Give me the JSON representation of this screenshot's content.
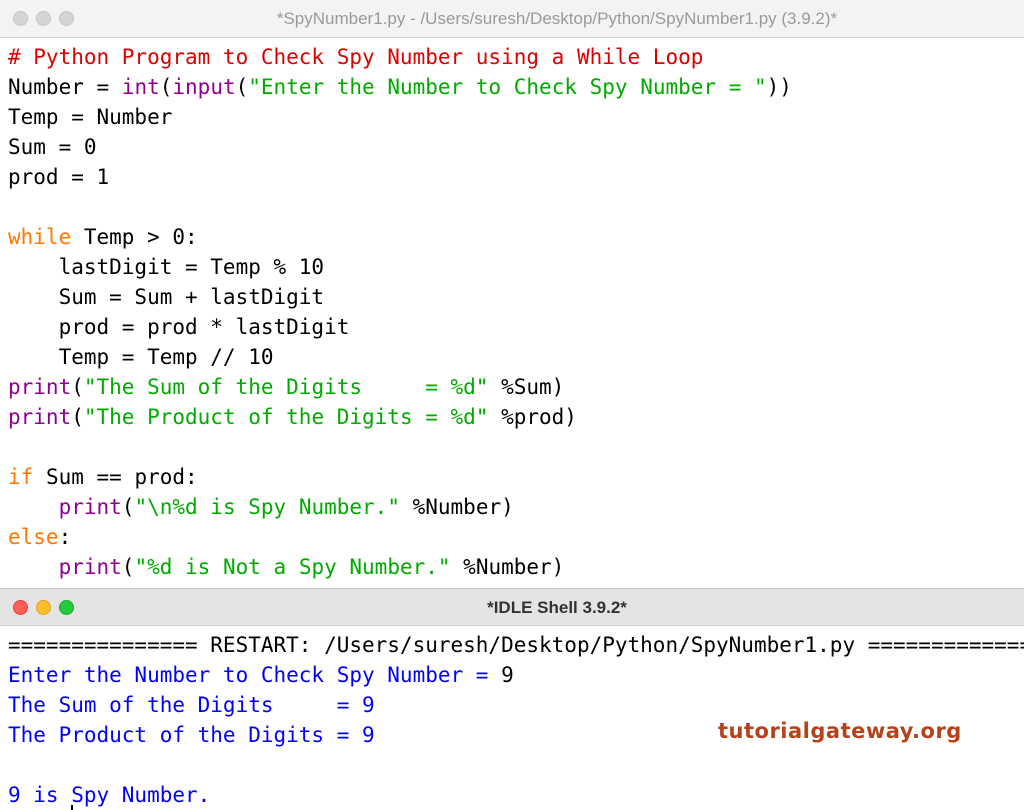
{
  "editor": {
    "title": "*SpyNumber1.py - /Users/suresh/Desktop/Python/SpyNumber1.py (3.9.2)*",
    "lines": [
      [
        {
          "t": "# Python Program to Check Spy Number using a While Loop",
          "c": "comment"
        }
      ],
      [
        {
          "t": "Number = ",
          "c": "plain"
        },
        {
          "t": "int",
          "c": "builtin"
        },
        {
          "t": "(",
          "c": "plain"
        },
        {
          "t": "input",
          "c": "builtin"
        },
        {
          "t": "(",
          "c": "plain"
        },
        {
          "t": "\"Enter the Number to Check Spy Number = \"",
          "c": "str"
        },
        {
          "t": "))",
          "c": "plain"
        }
      ],
      [
        {
          "t": "Temp = Number",
          "c": "plain"
        }
      ],
      [
        {
          "t": "Sum = 0",
          "c": "plain"
        }
      ],
      [
        {
          "t": "prod = 1",
          "c": "plain"
        }
      ],
      [
        {
          "t": "",
          "c": "plain"
        }
      ],
      [
        {
          "t": "while",
          "c": "kw"
        },
        {
          "t": " Temp > 0:",
          "c": "plain"
        }
      ],
      [
        {
          "t": "    lastDigit = Temp % 10",
          "c": "plain"
        }
      ],
      [
        {
          "t": "    Sum = Sum + lastDigit",
          "c": "plain"
        }
      ],
      [
        {
          "t": "    prod = prod * lastDigit",
          "c": "plain"
        }
      ],
      [
        {
          "t": "    Temp = Temp // 10",
          "c": "plain"
        }
      ],
      [
        {
          "t": "print",
          "c": "builtin"
        },
        {
          "t": "(",
          "c": "plain"
        },
        {
          "t": "\"The Sum of the Digits     = %d\"",
          "c": "str"
        },
        {
          "t": " %Sum)",
          "c": "plain"
        }
      ],
      [
        {
          "t": "print",
          "c": "builtin"
        },
        {
          "t": "(",
          "c": "plain"
        },
        {
          "t": "\"The Product of the Digits = %d\"",
          "c": "str"
        },
        {
          "t": " %prod)",
          "c": "plain"
        }
      ],
      [
        {
          "t": "",
          "c": "plain"
        }
      ],
      [
        {
          "t": "if",
          "c": "kw"
        },
        {
          "t": " Sum == prod:",
          "c": "plain"
        }
      ],
      [
        {
          "t": "    ",
          "c": "plain"
        },
        {
          "t": "print",
          "c": "builtin"
        },
        {
          "t": "(",
          "c": "plain"
        },
        {
          "t": "\"\\n%d is Spy Number.\"",
          "c": "str"
        },
        {
          "t": " %Number)",
          "c": "plain"
        }
      ],
      [
        {
          "t": "else",
          "c": "kw"
        },
        {
          "t": ":",
          "c": "plain"
        }
      ],
      [
        {
          "t": "    ",
          "c": "plain"
        },
        {
          "t": "print",
          "c": "builtin"
        },
        {
          "t": "(",
          "c": "plain"
        },
        {
          "t": "\"%d is Not a Spy Number.\"",
          "c": "str"
        },
        {
          "t": " %Number)",
          "c": "plain"
        }
      ]
    ]
  },
  "shell": {
    "title": "*IDLE Shell 3.9.2*",
    "lines": [
      [
        {
          "t": "=============== RESTART: /Users/suresh/Desktop/Python/SpyNumber1.py =============",
          "c": "plain"
        }
      ],
      [
        {
          "t": "Enter the Number to Check Spy Number = ",
          "c": "out"
        },
        {
          "t": "9",
          "c": "plain"
        }
      ],
      [
        {
          "t": "The Sum of the Digits     = 9",
          "c": "out"
        }
      ],
      [
        {
          "t": "The Product of the Digits = 9",
          "c": "out"
        }
      ],
      [
        {
          "t": "",
          "c": "plain"
        }
      ],
      [
        {
          "t": "9 is Spy Number.",
          "c": "out"
        }
      ]
    ]
  },
  "watermark": "tutorialgateway.org",
  "colors": {
    "comment": "#dd0000",
    "keyword": "#ff7700",
    "builtin": "#900090",
    "string": "#00aa00",
    "output": "#0000ff"
  }
}
